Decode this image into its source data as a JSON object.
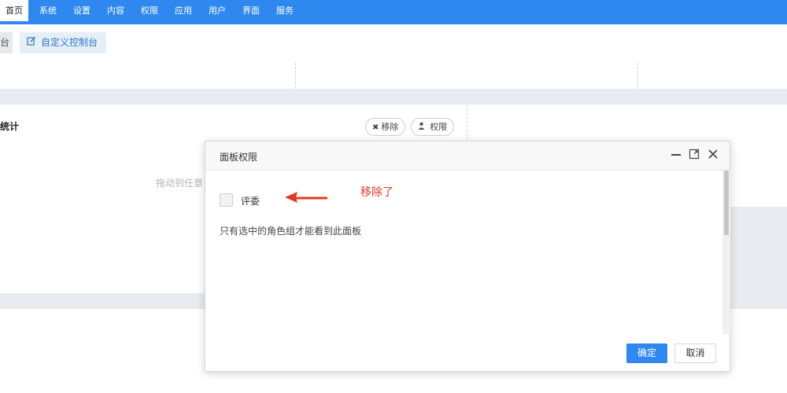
{
  "nav": {
    "items": [
      {
        "label": "首页",
        "active": true
      },
      {
        "label": "系统"
      },
      {
        "label": "设置"
      },
      {
        "label": "内容"
      },
      {
        "label": "权限"
      },
      {
        "label": "应用"
      },
      {
        "label": "用户"
      },
      {
        "label": "界面"
      },
      {
        "label": "服务"
      }
    ]
  },
  "toolbar": {
    "left_stub_label": "台",
    "custom_console_label": "自定义控制台",
    "custom_console_icon": "edit-icon"
  },
  "panel": {
    "title": "统计",
    "remove_label": "移除",
    "remove_icon": "times-icon",
    "perm_label": "权限",
    "perm_icon": "user-icon",
    "drag_hint": "拖动到任意"
  },
  "modal": {
    "title": "面板权限",
    "controls": [
      "minimize-icon",
      "maximize-icon",
      "close-icon"
    ],
    "checkbox_label": "评委",
    "checkbox_checked": false,
    "note": "只有选中的角色组才能看到此面板",
    "ok_label": "确定",
    "cancel_label": "取消"
  },
  "annotation": {
    "text": "移除了",
    "color": "#e23b1f"
  },
  "colors": {
    "primary": "#2e88f0",
    "band": "#e8ebef"
  }
}
